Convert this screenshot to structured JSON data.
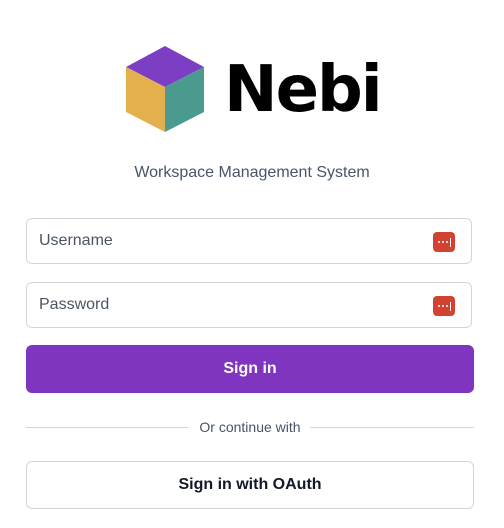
{
  "brand": {
    "name": "Nebi",
    "subtitle": "Workspace Management System",
    "colors": {
      "cube_top": "#7c3fc4",
      "cube_left": "#e4b04e",
      "cube_right": "#4a9a90"
    }
  },
  "login_form": {
    "username": {
      "placeholder": "Username",
      "value": "",
      "icon": "password-manager-icon"
    },
    "password": {
      "placeholder": "Password",
      "value": "",
      "icon": "password-manager-icon"
    },
    "sign_in_label": "Sign in",
    "divider_text": "Or continue with",
    "oauth_label": "Sign in with OAuth"
  },
  "colors": {
    "primary": "#8035c1",
    "password_icon": "#d1432f",
    "border": "#d1d5db"
  }
}
